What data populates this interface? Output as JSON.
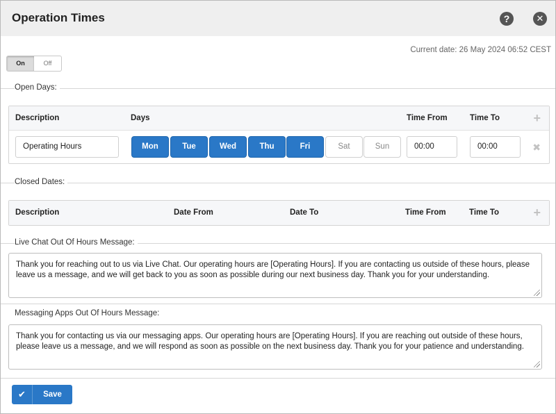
{
  "window": {
    "title": "Operation Times",
    "help_icon": "?",
    "close_icon": "✕"
  },
  "current_date": "Current date: 26 May 2024 06:52 CEST",
  "toggle": {
    "on_label": "On",
    "off_label": "Off",
    "selected": "On"
  },
  "open_days": {
    "section_label": "Open Days:",
    "headers": {
      "description": "Description",
      "days": "Days",
      "time_from": "Time From",
      "time_to": "Time To"
    },
    "add_icon": "+",
    "rows": [
      {
        "description": "Operating Hours",
        "days": [
          {
            "label": "Mon",
            "active": true
          },
          {
            "label": "Tue",
            "active": true
          },
          {
            "label": "Wed",
            "active": true
          },
          {
            "label": "Thu",
            "active": true
          },
          {
            "label": "Fri",
            "active": true
          },
          {
            "label": "Sat",
            "active": false
          },
          {
            "label": "Sun",
            "active": false
          }
        ],
        "time_from": "00:00",
        "time_to": "00:00",
        "remove_icon": "✖"
      }
    ]
  },
  "closed_dates": {
    "section_label": "Closed Dates:",
    "headers": {
      "description": "Description",
      "date_from": "Date From",
      "date_to": "Date To",
      "time_from": "Time From",
      "time_to": "Time To"
    },
    "add_icon": "+"
  },
  "live_chat": {
    "section_label": "Live Chat Out Of Hours Message:",
    "message": "Thank you for reaching out to us via Live Chat. Our operating hours are [Operating Hours]. If you are contacting us outside of these hours, please leave us a message, and we will get back to you as soon as possible during our next business day. Thank you for your understanding."
  },
  "messaging_apps": {
    "section_label": "Messaging Apps Out Of Hours Message:",
    "message": "Thank you for contacting us via our messaging apps. Our operating hours are [Operating Hours]. If you are reaching out outside of these hours, please leave us a message, and we will respond as soon as possible on the next business day. Thank you for your patience and understanding."
  },
  "save_button": {
    "icon": "✔",
    "label": "Save"
  },
  "colors": {
    "accent": "#2a78c7",
    "titlebar": "#efefef"
  }
}
